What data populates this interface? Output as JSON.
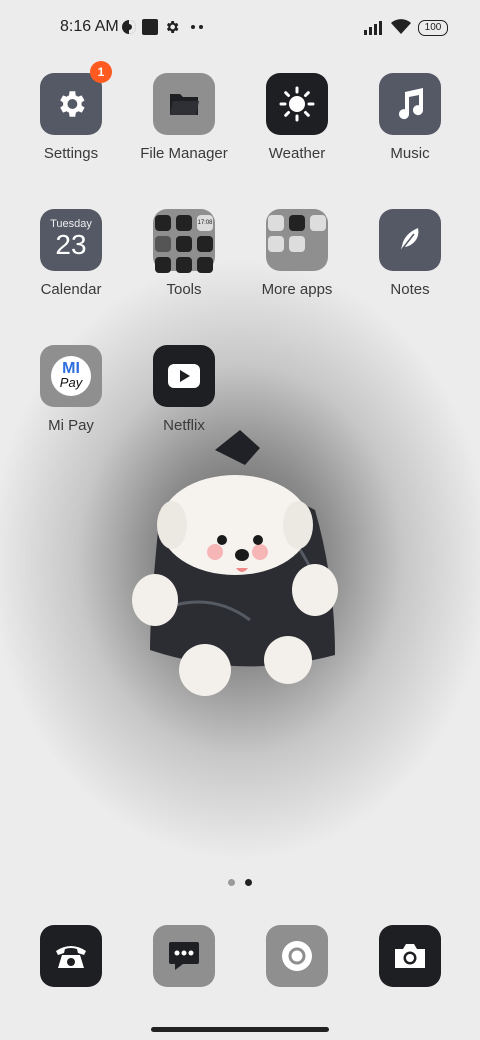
{
  "status_bar": {
    "time": "8:16 AM",
    "battery": "100",
    "icons": [
      "vpn-icon",
      "square-icon",
      "gear-icon",
      "more-dots-icon",
      "signal-icon",
      "wifi-icon",
      "battery-icon"
    ]
  },
  "apps": [
    {
      "label": "Settings",
      "badge": "1",
      "icon": "gear-icon"
    },
    {
      "label": "File Manager",
      "icon": "folder-icon"
    },
    {
      "label": "Weather",
      "icon": "sun-icon"
    },
    {
      "label": "Music",
      "icon": "music-note-icon"
    },
    {
      "label": "Calendar",
      "icon": "calendar-icon",
      "day": "Tuesday",
      "date": "23"
    },
    {
      "label": "Tools",
      "icon": "folder-tools-icon"
    },
    {
      "label": "More apps",
      "icon": "folder-more-apps-icon"
    },
    {
      "label": "Notes",
      "icon": "feather-icon"
    },
    {
      "label": "Mi Pay",
      "icon": "mi-pay-icon",
      "logo_top": "MI",
      "logo_bottom": "Pay"
    },
    {
      "label": "Netflix",
      "icon": "play-icon"
    }
  ],
  "folders": {
    "tools_time": "17:08"
  },
  "page_indicator": {
    "pages": 2,
    "current": 2
  },
  "dock": [
    {
      "name": "phone",
      "icon": "phone-icon"
    },
    {
      "name": "messages",
      "icon": "message-icon"
    },
    {
      "name": "browser",
      "icon": "browser-icon"
    },
    {
      "name": "camera",
      "icon": "camera-icon"
    }
  ],
  "colors": {
    "accent_badge": "#ff5a1f",
    "tile_dark": "#1e1f22",
    "tile_slate": "#555966",
    "tile_gray": "#8f8f8f"
  }
}
